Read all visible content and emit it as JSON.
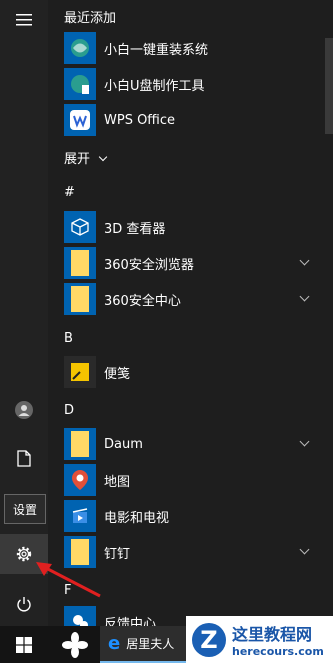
{
  "rail": {
    "tooltip": "设置"
  },
  "sections": {
    "recent": "最近添加",
    "expand": "展开",
    "hash": "#",
    "b": "B",
    "d": "D",
    "f": "F"
  },
  "apps": {
    "xiaobai_install": "小白一键重装系统",
    "xiaobai_usb": "小白U盘制作工具",
    "wps": "WPS Office",
    "viewer3d": "3D 查看器",
    "browser360": "360安全浏览器",
    "center360": "360安全中心",
    "notes": "便笺",
    "daum": "Daum",
    "maps": "地图",
    "movies": "电影和电视",
    "dingtalk": "钉钉",
    "feedback": "反馈中心"
  },
  "taskbar": {
    "task_label": "居里夫人"
  },
  "watermark": {
    "title": "这里教程网",
    "url": "herecours.com"
  },
  "colors": {
    "tile_blue": "#0063b1",
    "folder_yellow": "#ffd966"
  }
}
